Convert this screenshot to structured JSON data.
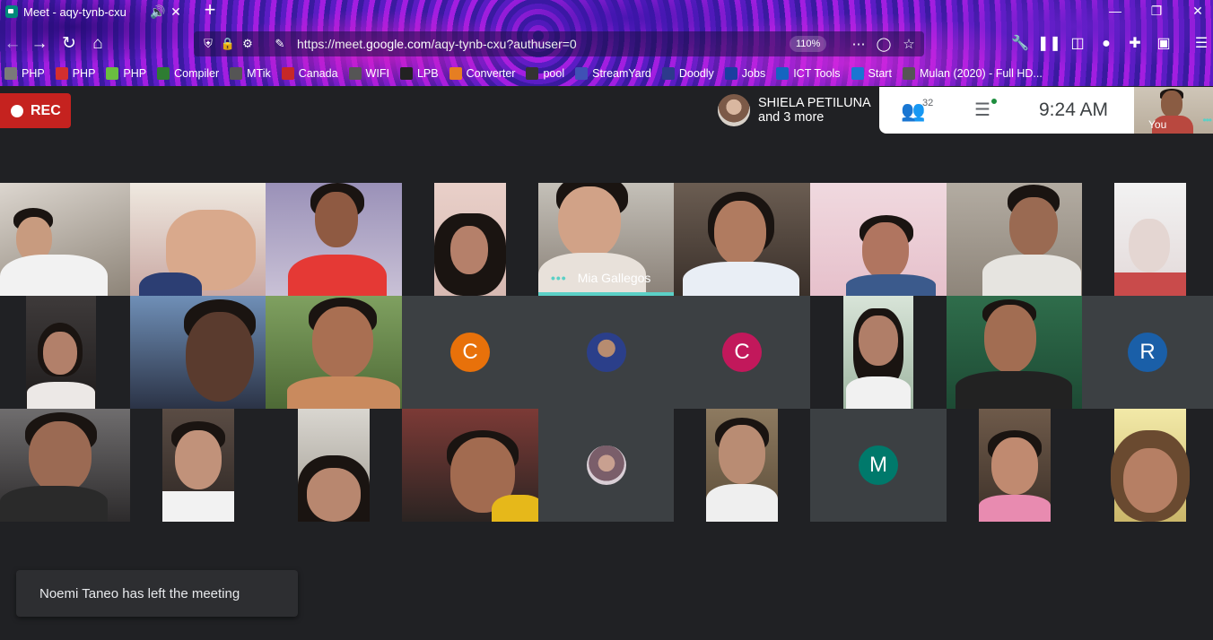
{
  "browser": {
    "tab_title": "Meet - aqy-tynb-cxu",
    "url_prefix": "https://meet.",
    "url_domain": "google.com",
    "url_path": "/aqy-tynb-cxu?authuser=0",
    "zoom": "110%",
    "bookmarks": [
      {
        "label": "PHP",
        "color": "#7a7a7a",
        "icon": "php-icon"
      },
      {
        "label": "PHP",
        "color": "#d32f2f",
        "icon": "php-v-icon"
      },
      {
        "label": "PHP",
        "color": "#6abf40",
        "icon": "php-icon"
      },
      {
        "label": "Compiler",
        "color": "#2e7d32",
        "icon": "code-icon"
      },
      {
        "label": "MTik",
        "color": "#555555",
        "icon": "globe-icon"
      },
      {
        "label": "Canada",
        "color": "#c62828",
        "icon": "maple-leaf-icon"
      },
      {
        "label": "WIFI",
        "color": "#555555",
        "icon": "globe-icon"
      },
      {
        "label": "LPB",
        "color": "#222222",
        "icon": "lpb-icon"
      },
      {
        "label": "Converter",
        "color": "#e67e22",
        "icon": "converter-icon"
      },
      {
        "label": "pool",
        "color": "#333333",
        "icon": "pool-icon"
      },
      {
        "label": "StreamYard",
        "color": "#3f51b5",
        "icon": "streamyard-icon"
      },
      {
        "label": "Doodly",
        "color": "#2d3a8c",
        "icon": "doodly-icon"
      },
      {
        "label": "Jobs",
        "color": "#1a3fa0",
        "icon": "jobs-icon"
      },
      {
        "label": "ICT Tools",
        "color": "#1565c0",
        "icon": "ict-icon"
      },
      {
        "label": "Start",
        "color": "#1976d2",
        "icon": "start-icon"
      },
      {
        "label": "Mulan (2020) - Full HD...",
        "color": "#555555",
        "icon": "globe-icon"
      }
    ]
  },
  "meet": {
    "rec_label": "REC",
    "presenter_name": "SHIELA PETILUNA",
    "presenter_more": "and 3 more",
    "participants_count": "32",
    "time": "9:24  AM",
    "self_label": "You",
    "speaking_name": "Mia Gallegos",
    "toast": "Noemi Taneo has left the meeting",
    "letters": {
      "c1": "C",
      "c2": "C",
      "r": "R",
      "m": "M"
    },
    "colors": {
      "accent": "#5bd0c6",
      "rec": "#c5221f",
      "avatar_orange": "#e8710a",
      "avatar_pink": "#c2185b",
      "avatar_blue": "#1a5fa8",
      "avatar_teal": "#00796b"
    }
  }
}
